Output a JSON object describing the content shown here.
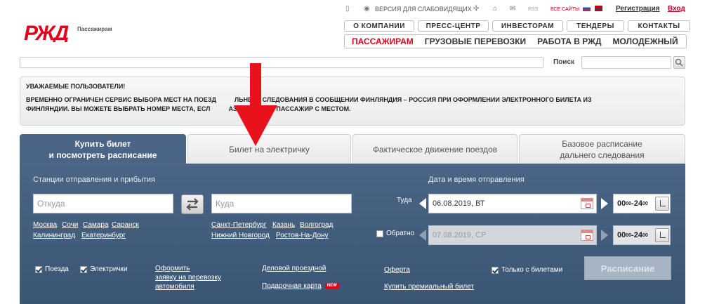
{
  "util": {
    "version_label": "ВЕРСИЯ ДЛЯ СЛАБОВИДЯЩИХ",
    "rss": "RSS",
    "all_sites": "ВСЕ САЙТЫ",
    "register": "Регистрация",
    "login": "Вход"
  },
  "logo": {
    "text": "РЖД",
    "sub": "Пассажирам",
    "color": "#e2001a"
  },
  "nav_top": [
    "О КОМПАНИИ",
    "ПРЕСС-ЦЕНТР",
    "ИНВЕСТОРАМ",
    "ТЕНДЕРЫ",
    "КОНТАКТЫ"
  ],
  "nav_main": [
    "ПАССАЖИРАМ",
    "ГРУЗОВЫЕ ПЕРЕВОЗКИ",
    "РАБОТА В РЖД",
    "МОЛОДЕЖНЫЙ"
  ],
  "search": {
    "label": "Поиск",
    "placeholder": ""
  },
  "notice": {
    "title": "УВАЖАЕМЫЕ ПОЛЬЗОВАТЕЛИ!",
    "line1": "ВРЕМЕННО ОГРАНИЧЕН СЕРВИС ВЫБОРА МЕСТ НА ПОЕЗД",
    "line1b": "ЛЬНЕГО СЛЕДОВАНИЯ В СООБЩЕНИИ ФИНЛЯНДИЯ – РОССИЯ ПРИ ОФОРМЛЕНИИ ЭЛЕКТРОННОГО БИЛЕТА ИЗ",
    "line2": "ФИНЛЯНДИИ. ВЫ МОЖЕТЕ ВЫБРАТЬ НОМЕР МЕСТА, ЕСЛ",
    "line2b": "АЗЕ ТОЛЬКО 1 ПАССАЖИР С МЕСТОМ."
  },
  "tabs": [
    {
      "line1": "Купить билет",
      "line2": "и посмотреть расписание"
    },
    {
      "line1": "Билет на электричку",
      "line2": ""
    },
    {
      "line1": "Фактическое движение поездов",
      "line2": ""
    },
    {
      "line1": "Базовое расписание",
      "line2": "дальнего следования"
    }
  ],
  "form": {
    "stations_header": "Станции отправления и прибытия",
    "from_placeholder": "Откуда",
    "to_placeholder": "Куда",
    "from_links": [
      "Москва",
      "Сочи",
      "Самара",
      "Саранск",
      "Калининград",
      "Екатеринбург"
    ],
    "to_links": [
      "Санкт-Петербург",
      "Казань",
      "Волгоград",
      "Нижний Новгород",
      "Ростов-На-Дону"
    ],
    "date_header": "Дата и время отправления",
    "there_label": "Туда",
    "there_date": "06.08.2019, ВТ",
    "back_label": "Обратно",
    "back_date": "07.08.2019, СР",
    "time_from": "00",
    "time_from_sup": "00",
    "time_sep": "-",
    "time_to": "24",
    "time_to_sup": "00",
    "chk_trains": "Поезда",
    "chk_elektrichki": "Электрички",
    "car_link_1": "Оформить",
    "car_link_2": "заявку на перевозку",
    "car_link_3": "автомобиля",
    "business_pass": "Деловой проездной",
    "gift_card": "Подарочная карта",
    "new_badge": "NEW",
    "offer": "Оферта",
    "premium_ticket": "Купить премиальный билет",
    "only_with_tickets": "Только с билетами",
    "schedule_button": "Расписание"
  },
  "colors": {
    "brand_red": "#e2001a",
    "panel_blue": "#4a6585",
    "arrow_red": "#e8121c"
  }
}
